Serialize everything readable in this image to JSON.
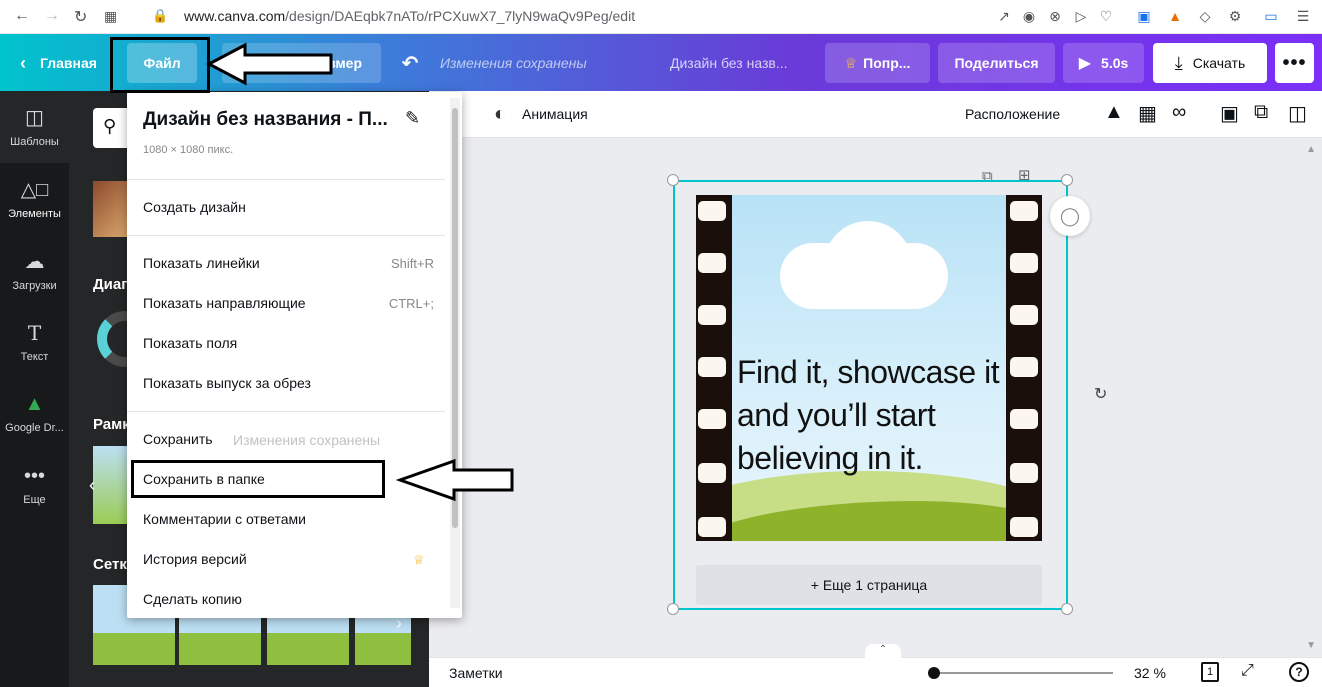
{
  "browser": {
    "url_prefix": "www.canva.com",
    "url_path": "/design/DAEqbk7nATo/rPCXuwX7_7lyN9waQv9Peg/edit"
  },
  "header": {
    "home_label": "Главная",
    "file_label": "Файл",
    "resize_label": "Изменить размер",
    "saved_status": "Изменения сохранены",
    "doc_title": "Дизайн без назв...",
    "upgrade_label": "Попр...",
    "share_label": "Поделиться",
    "play_label": "5.0s",
    "download_label": "Скачать"
  },
  "rail": [
    {
      "label": "Шаблоны",
      "icon": "templates-icon"
    },
    {
      "label": "Элементы",
      "icon": "elements-icon"
    },
    {
      "label": "Загрузки",
      "icon": "upload-icon"
    },
    {
      "label": "Текст",
      "icon": "text-icon"
    },
    {
      "label": "Google Dr...",
      "icon": "google-drive-icon"
    },
    {
      "label": "Еще",
      "icon": "more-icon"
    }
  ],
  "panel": {
    "section1": "Диаг",
    "section2": "Рамк",
    "section3": "Сетк"
  },
  "file_menu": {
    "title": "Дизайн без названия - П...",
    "size": "1080 × 1080 пикс.",
    "items": [
      {
        "label": "Создать дизайн"
      },
      {
        "label": "Показать линейки",
        "shortcut": "Shift+R"
      },
      {
        "label": "Показать направляющие",
        "shortcut": "CTRL+;"
      },
      {
        "label": "Показать поля"
      },
      {
        "label": "Показать выпуск за обрез"
      },
      {
        "label": "Сохранить",
        "note": "Изменения сохранены"
      },
      {
        "label": "Сохранить в папке"
      },
      {
        "label": "Комментарии с ответами"
      },
      {
        "label": "История версий"
      },
      {
        "label": "Сделать копию"
      }
    ]
  },
  "toolbar": {
    "animation_label": "Анимация",
    "position_label": "Расположение"
  },
  "design": {
    "quote": "Find it, showcase it and you’ll start believing in it.",
    "more_pages": "+ Еще 1 страница"
  },
  "bottom": {
    "notes_label": "Заметки",
    "zoom": "32 %",
    "page_count": "1"
  },
  "colors": {
    "accent": "#00c4cc",
    "purple": "#7b2ff7",
    "rail": "#18191b",
    "panel": "#252627"
  }
}
